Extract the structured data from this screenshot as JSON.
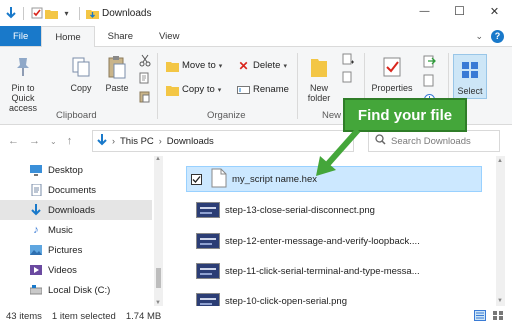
{
  "window": {
    "title": "Downloads",
    "minimize_glyph": "—",
    "maximize_glyph": "☐",
    "close_glyph": "✕"
  },
  "tabs": [
    {
      "label": "File"
    },
    {
      "label": "Home"
    },
    {
      "label": "Share"
    },
    {
      "label": "View"
    }
  ],
  "ribbon": {
    "pin_label": "Pin to Quick access",
    "copy_label": "Copy",
    "paste_label": "Paste",
    "clipboard_group": "Clipboard",
    "move_to": "Move to",
    "copy_to": "Copy to",
    "delete": "Delete",
    "rename": "Rename",
    "organize_group": "Organize",
    "new_folder": "New folder",
    "new_group": "New",
    "properties": "Properties",
    "select": "Select"
  },
  "address": {
    "path": [
      "This PC",
      "Downloads"
    ],
    "search_placeholder": "Search Downloads"
  },
  "nav_items": [
    {
      "label": "Desktop",
      "icon": "desktop-icon"
    },
    {
      "label": "Documents",
      "icon": "documents-icon"
    },
    {
      "label": "Downloads",
      "icon": "downloads-icon"
    },
    {
      "label": "Music",
      "icon": "music-icon"
    },
    {
      "label": "Pictures",
      "icon": "pictures-icon"
    },
    {
      "label": "Videos",
      "icon": "videos-icon"
    },
    {
      "label": "Local Disk (C:)",
      "icon": "drive-icon"
    }
  ],
  "files": [
    {
      "name": "my_script name.hex",
      "type": "file"
    },
    {
      "name": "step-13-close-serial-disconnect.png",
      "type": "image"
    },
    {
      "name": "step-12-enter-message-and-verify-loopback....",
      "type": "image"
    },
    {
      "name": "step-11-click-serial-terminal-and-type-messa...",
      "type": "image"
    },
    {
      "name": "step-10-click-open-serial.png",
      "type": "image"
    }
  ],
  "callout": {
    "text": "Find your file",
    "color": "#44a63a"
  },
  "status": {
    "count": "43 items",
    "selection": "1 item selected",
    "size": "1.74 MB"
  },
  "colors": {
    "accent": "#1979ca",
    "selection": "#cce8ff"
  }
}
